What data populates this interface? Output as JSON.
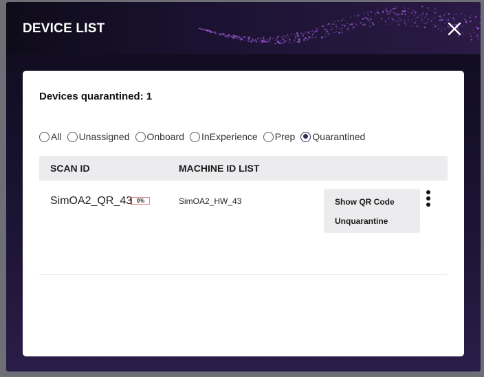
{
  "dialog": {
    "title": "DEVICE LIST"
  },
  "summary": {
    "label": "Devices quarantined:",
    "count": "1"
  },
  "filters": [
    {
      "label": "All",
      "checked": false
    },
    {
      "label": "Unassigned",
      "checked": false
    },
    {
      "label": "Onboard",
      "checked": false
    },
    {
      "label": "InExperience",
      "checked": false
    },
    {
      "label": "Prep",
      "checked": false
    },
    {
      "label": "Quarantined",
      "checked": true
    }
  ],
  "table": {
    "columns": [
      "SCAN ID",
      "MACHINE ID LIST"
    ],
    "rows": [
      {
        "scan_id": "SimOA2_QR_43",
        "progress": "0%",
        "machine_id": "SimOA2_HW_43"
      }
    ]
  },
  "row_menu": {
    "items": [
      "Show QR Code",
      "Unquarantine"
    ]
  },
  "colors": {
    "accent": "#3b2a5c",
    "header_bg": "#0e0b19",
    "panel_bg": "#ffffff",
    "table_header_bg": "#ececef"
  }
}
